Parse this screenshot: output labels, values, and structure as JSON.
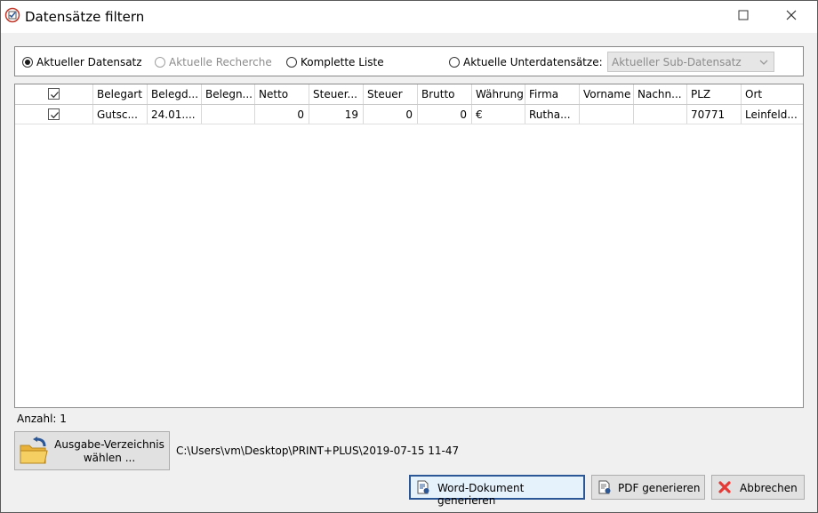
{
  "window": {
    "title": "Datensätze filtern",
    "icon": "app-icon"
  },
  "filter": {
    "options": [
      {
        "label": "Aktueller Datensatz",
        "checked": true,
        "disabled": false
      },
      {
        "label": "Aktuelle Recherche",
        "checked": false,
        "disabled": true
      },
      {
        "label": "Komplette Liste",
        "checked": false,
        "disabled": false
      },
      {
        "label": "Aktuelle Unterdatensätze:",
        "checked": false,
        "disabled": false
      }
    ],
    "sub_select_value": "Aktueller Sub-Datensatz"
  },
  "grid": {
    "columns": [
      "",
      "Belegart",
      "Belegd...",
      "Belegn...",
      "Netto",
      "Steuer...",
      "Steuer",
      "Brutto",
      "Währung",
      "Firma",
      "Vorname",
      "Nachn...",
      "PLZ",
      "Ort"
    ],
    "rows": [
      {
        "checked": true,
        "cells": [
          "",
          "Gutsc...",
          "24.01....",
          "",
          "0",
          "19",
          "0",
          "0",
          "€",
          "Rutha...",
          "",
          "",
          "70771",
          "Leinfeld..."
        ]
      }
    ]
  },
  "footer": {
    "count_label": "Anzahl: 1",
    "folder_button_line1": "Ausgabe-Verzeichnis",
    "folder_button_line2": "wählen ...",
    "output_path": "C:\\Users\\vm\\Desktop\\PRINT+PLUS\\2019-07-15 11-47",
    "word_button": "Word-Dokument generieren",
    "pdf_button": "PDF generieren",
    "cancel_button": "Abbrechen"
  },
  "colors": {
    "accent": "#2b5797",
    "cancel_icon": "#e53935",
    "folder": "#f2c24b"
  }
}
